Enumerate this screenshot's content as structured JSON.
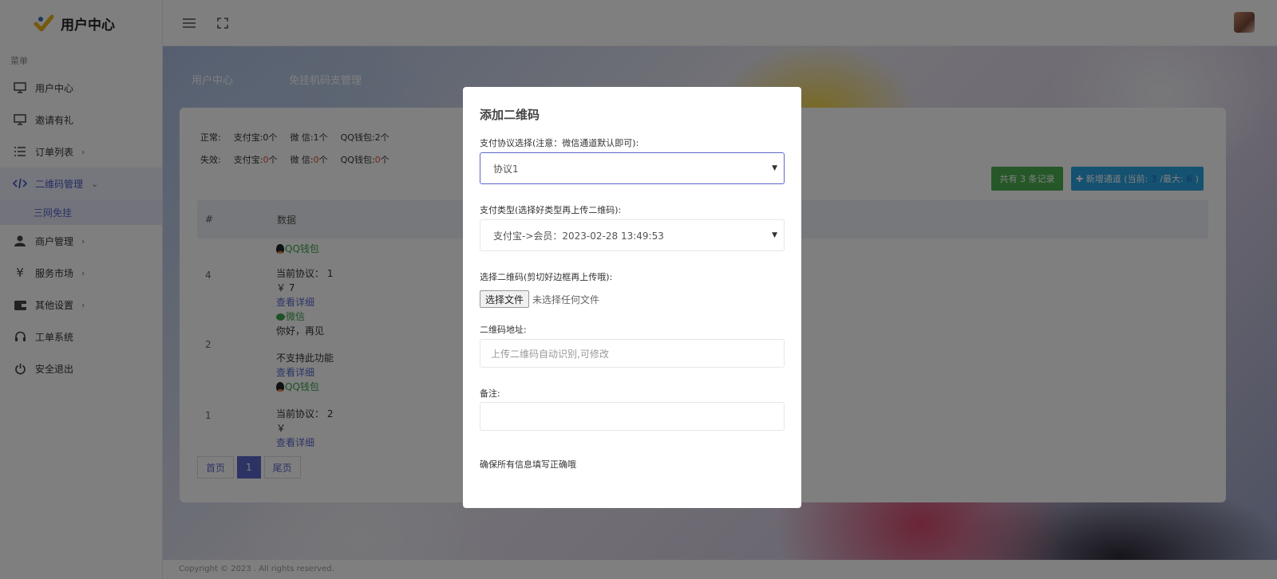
{
  "brand": {
    "name": "用户中心"
  },
  "sidebar": {
    "caption": "菜单",
    "items": [
      {
        "label": "用户中心",
        "icon": "monitor-icon",
        "caret": ""
      },
      {
        "label": "邀请有礼",
        "icon": "monitor-icon",
        "caret": ""
      },
      {
        "label": "订单列表",
        "icon": "list-icon",
        "caret": "›"
      },
      {
        "label": "二维码管理",
        "icon": "code-icon",
        "caret": "⌄"
      },
      {
        "label": "商户管理",
        "icon": "user-icon",
        "caret": "›"
      },
      {
        "label": "服务市场",
        "icon": "yen-icon",
        "caret": "›"
      },
      {
        "label": "其他设置",
        "icon": "wallet-icon",
        "caret": "›"
      },
      {
        "label": "工单系统",
        "icon": "headset-icon",
        "caret": ""
      },
      {
        "label": "安全退出",
        "icon": "power-icon",
        "caret": ""
      }
    ],
    "sub_item": "三网免挂"
  },
  "breadcrumb": {
    "home": "用户中心",
    "current": "免挂机码支管理"
  },
  "stats": {
    "normal_label": "正常:",
    "normal_alipay": "支付宝:0个",
    "normal_wechat": "微 信:1个",
    "normal_qq": "QQ钱包:2个",
    "fail_label": "失效:",
    "fail_alipay_prefix": "支付宝:",
    "fail_alipay_num": "0",
    "fail_alipay_suffix": "个",
    "fail_wechat_prefix": "微 信:",
    "fail_wechat_num": "0",
    "fail_wechat_suffix": "个",
    "fail_qq_prefix": "QQ钱包:",
    "fail_qq_num": "0",
    "fail_qq_suffix": "个"
  },
  "toolbar": {
    "total_label": "共有 3 条记录",
    "add_label_prefix": "✚ 新增通道 (当前:",
    "add_current": "3",
    "add_middle": "/最大:",
    "add_max": "6",
    "add_suffix": ")"
  },
  "table": {
    "headers": [
      "#",
      "数据"
    ],
    "rows": [
      {
        "id": "",
        "type": "QQ钱包",
        "line1": "",
        "line2": "",
        "link": ""
      },
      {
        "id": "4",
        "type": "",
        "line1": "当前协议： 1",
        "line2": "￥ 7",
        "link": "查看详细"
      },
      {
        "id": "2",
        "type": "微信",
        "line1": "你好，再见",
        "line2": "不支持此功能",
        "link": "查看详细"
      },
      {
        "id": "1",
        "type": "QQ钱包",
        "line1": "当前协议： 2",
        "line2": "￥",
        "link": "查看详细"
      }
    ]
  },
  "pager": {
    "first": "首页",
    "current": "1",
    "last": "尾页"
  },
  "footer": {
    "text": "Copyright © 2023 . All rights reserved."
  },
  "modal": {
    "title": "添加二维码",
    "protocol_label": "支付协议选择(注意：微信通道默认即可):",
    "protocol_value": "协议1",
    "paytype_label": "支付类型(选择好类型再上传二维码):",
    "paytype_value": "支付宝->会员：2023-02-28 13:49:53",
    "qr_label": "选择二维码(剪切好边框再上传哦):",
    "file_button": "选择文件",
    "file_none": "未选择任何文件",
    "addr_label": "二维码地址:",
    "addr_placeholder": "上传二维码自动识别,可修改",
    "remark_label": "备注:",
    "remark_value": "",
    "note": "确保所有信息填写正确哦"
  },
  "colors": {
    "accent": "#5b67c9",
    "success": "#4caf50",
    "info": "#2ba3e0",
    "danger": "#e74c3c"
  }
}
